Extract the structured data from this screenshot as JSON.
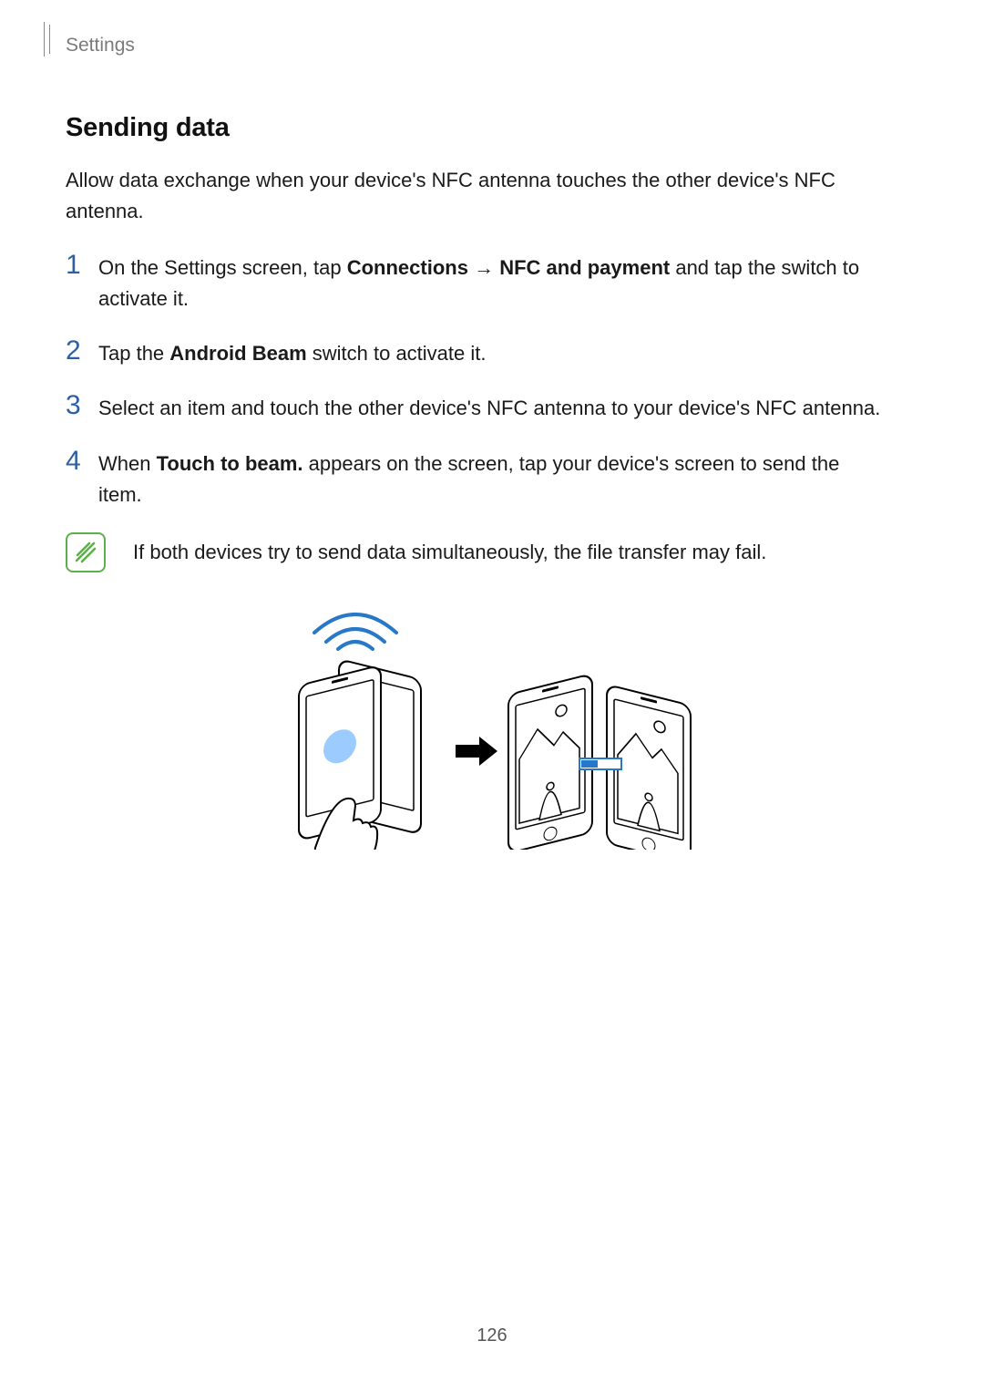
{
  "header": {
    "section": "Settings"
  },
  "title": "Sending data",
  "intro": "Allow data exchange when your device's NFC antenna touches the other device's NFC antenna.",
  "steps": {
    "s1_a": "On the Settings screen, tap ",
    "s1_b1": "Connections",
    "s1_arrow": " → ",
    "s1_b2": "NFC and payment",
    "s1_c": " and tap the switch to activate it.",
    "s2_a": "Tap the ",
    "s2_b": "Android Beam",
    "s2_c": " switch to activate it.",
    "s3": "Select an item and touch the other device's NFC antenna to your device's NFC antenna.",
    "s4_a": "When ",
    "s4_b": "Touch to beam.",
    "s4_c": " appears on the screen, tap your device's screen to send the item."
  },
  "note": "If both devices try to send data simultaneously, the file transfer may fail.",
  "page_number": "126"
}
